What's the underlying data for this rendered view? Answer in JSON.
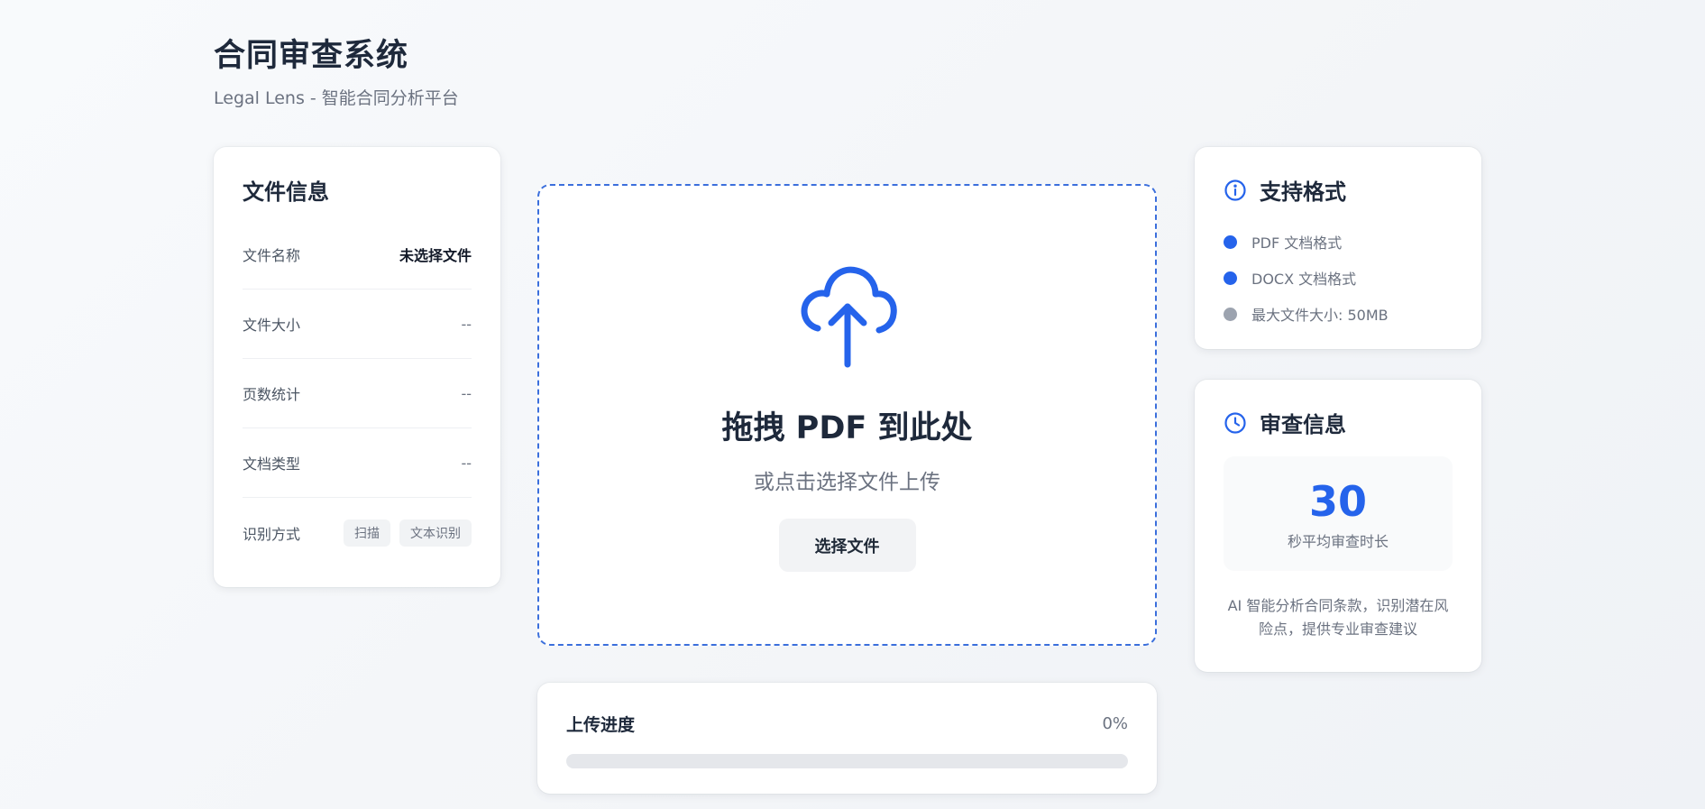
{
  "header": {
    "title": "合同审查系统",
    "subtitle": "Legal Lens - 智能合同分析平台"
  },
  "file_info": {
    "title": "文件信息",
    "rows": [
      {
        "label": "文件名称",
        "value": "未选择文件"
      },
      {
        "label": "文件大小",
        "value": "--"
      },
      {
        "label": "页数统计",
        "value": "--"
      },
      {
        "label": "文档类型",
        "value": "--"
      }
    ],
    "recognition": {
      "label": "识别方式",
      "tags": [
        "扫描",
        "文本识别"
      ]
    }
  },
  "dropzone": {
    "icon": "cloud-upload-icon",
    "title": "拖拽 PDF 到此处",
    "subtitle": "或点击选择文件上传",
    "button_label": "选择文件"
  },
  "upload_progress": {
    "title": "上传进度",
    "percent_label": "0%",
    "percent": 0
  },
  "formats": {
    "icon": "info-icon",
    "title": "支持格式",
    "items": [
      {
        "text": "PDF 文档格式",
        "color": "#2563eb"
      },
      {
        "text": "DOCX 文档格式",
        "color": "#2563eb"
      },
      {
        "text": "最大文件大小: 50MB",
        "color": "#9ca3af"
      }
    ]
  },
  "review": {
    "icon": "clock-icon",
    "title": "审查信息",
    "stat_value": "30",
    "stat_label": "秒平均审查时长",
    "description": "AI 智能分析合同条款，识别潜在风险点，提供专业审查建议"
  },
  "colors": {
    "accent": "#2563eb",
    "muted_dot": "#9ca3af"
  }
}
